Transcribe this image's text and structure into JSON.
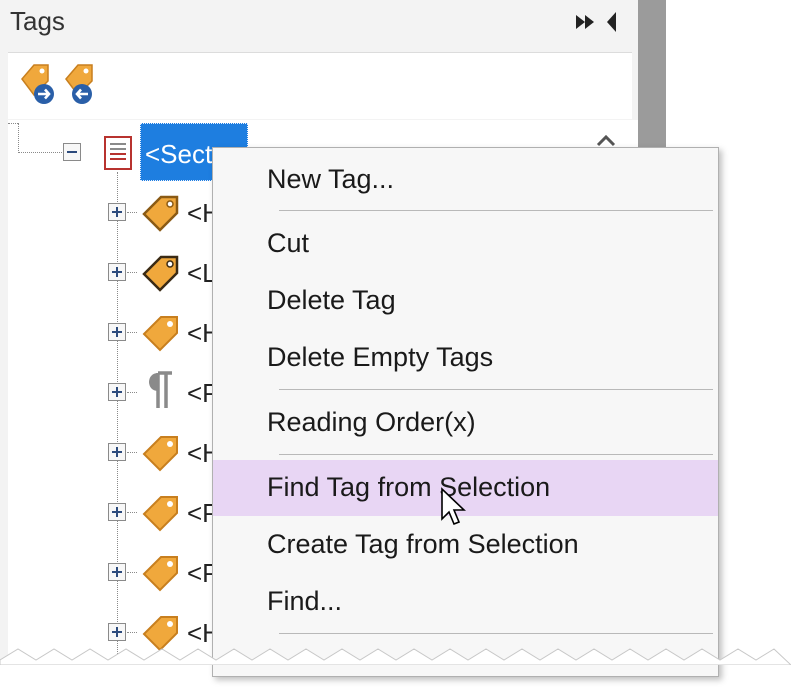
{
  "panel": {
    "title": "Tags",
    "controls": [
      "expand-panel-icon",
      "collapse-panel-icon"
    ],
    "toolbar": [
      "tag-arrow-right-icon",
      "tag-arrow-left-icon"
    ]
  },
  "tree": {
    "root": {
      "label": "<Sect>",
      "visible_label": "<Sect",
      "icon": "section-icon",
      "expanded": true,
      "selected": true
    },
    "children": [
      {
        "label": "<H",
        "icon": "tag-icon"
      },
      {
        "label": "<L",
        "icon": "tag-icon"
      },
      {
        "label": "<H",
        "icon": "tag-icon"
      },
      {
        "label": "<P",
        "icon": "paragraph-icon"
      },
      {
        "label": "<H",
        "icon": "tag-icon"
      },
      {
        "label": "<P",
        "icon": "tag-icon"
      },
      {
        "label": "<P",
        "icon": "tag-icon"
      },
      {
        "label": "<H",
        "icon": "tag-icon"
      }
    ]
  },
  "context_menu": {
    "items": [
      "New Tag...",
      "Cut",
      "Delete Tag",
      "Delete Empty Tags",
      "Reading Order(x)",
      "Find Tag from Selection",
      "Create Tag from Selection",
      "Find..."
    ],
    "highlighted": "Find Tag from Selection",
    "highlight_color": "#e8d6f4"
  },
  "colors": {
    "selection": "#1e7ee0",
    "tag_icon": "#f0a83c",
    "panel_bg": "#f3f3f3"
  }
}
